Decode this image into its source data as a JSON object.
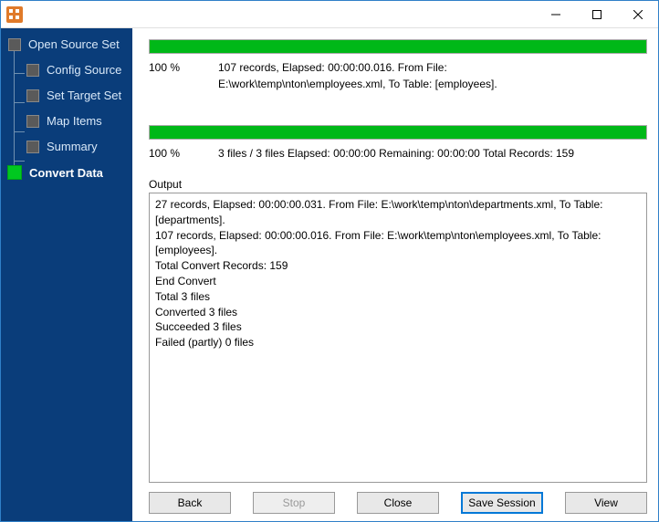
{
  "nav": {
    "items": [
      {
        "label": "Open Source Set",
        "child": false
      },
      {
        "label": "Config Source",
        "child": true
      },
      {
        "label": "Set Target Set",
        "child": true
      },
      {
        "label": "Map Items",
        "child": true
      },
      {
        "label": "Summary",
        "child": true
      },
      {
        "label": "Convert Data",
        "child": false,
        "active": true
      }
    ]
  },
  "progress1": {
    "percent": "100 %",
    "line1": "107 records,    Elapsed: 00:00:00.016.    From File:",
    "line2": "E:\\work\\temp\\nton\\employees.xml,    To Table: [employees]."
  },
  "progress2": {
    "percent": "100 %",
    "details": "3 files / 3 files    Elapsed: 00:00:00    Remaining: 00:00:00    Total Records: 159"
  },
  "output": {
    "label": "Output",
    "lines": [
      "27 records,    Elapsed: 00:00:00.031.    From File: E:\\work\\temp\\nton\\departments.xml,    To Table: [departments].",
      "107 records,    Elapsed: 00:00:00.016.    From File: E:\\work\\temp\\nton\\employees.xml,    To Table: [employees].",
      "Total Convert Records: 159",
      "End Convert",
      "Total 3 files",
      "Converted 3 files",
      "Succeeded 3 files",
      "Failed (partly) 0 files"
    ]
  },
  "buttons": {
    "back": "Back",
    "stop": "Stop",
    "close": "Close",
    "save": "Save Session",
    "view": "View"
  }
}
